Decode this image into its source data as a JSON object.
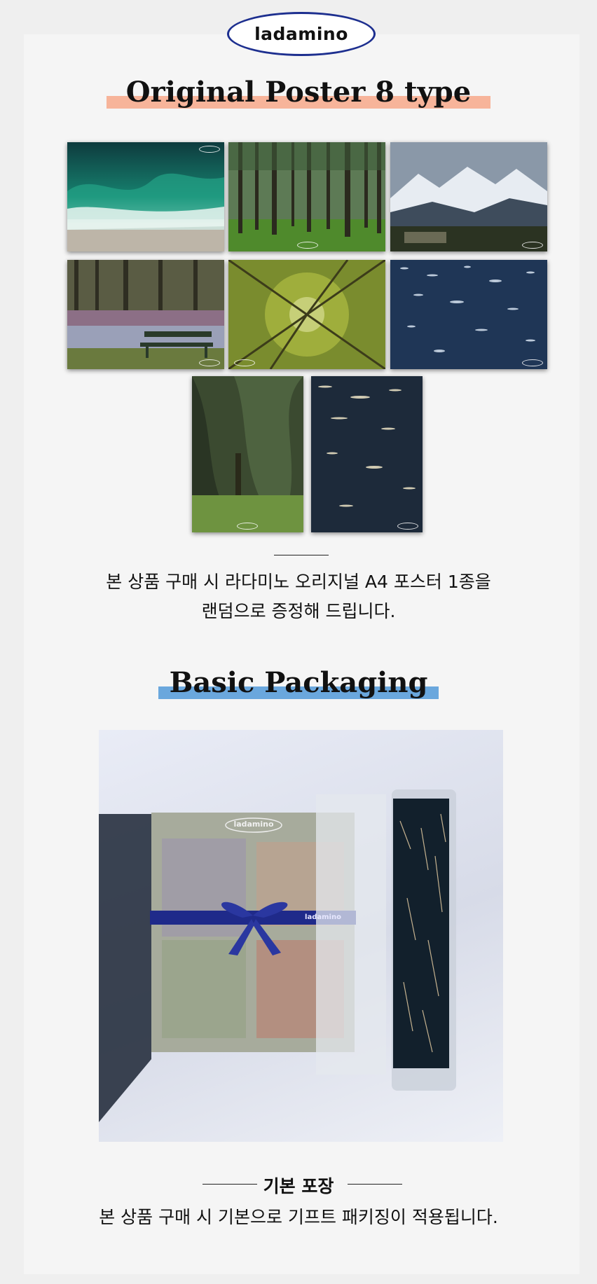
{
  "brand": {
    "logo_text": "ladamino",
    "logo_border_color": "#1d2f8f"
  },
  "poster_section": {
    "title": "Original Poster 8 type",
    "highlight_color": "#f7b49a",
    "photos": [
      {
        "subject": "ocean wave"
      },
      {
        "subject": "pine forest"
      },
      {
        "subject": "snowy mountains"
      },
      {
        "subject": "park bench by pond"
      },
      {
        "subject": "looking up at tree canopy"
      },
      {
        "subject": "sparkling water surface"
      },
      {
        "subject": "weeping willow trees"
      },
      {
        "subject": "glittering dark water"
      }
    ],
    "description_line1": "본 상품 구매 시 라다미노 오리지널 A4 포스터 1종을",
    "description_line2": "랜덤으로 증정해 드립니다."
  },
  "packaging_section": {
    "title": "Basic Packaging",
    "highlight_color": "#6aa7dd",
    "box_logo": "ladamino",
    "ribbon_text": "ladamino",
    "caption_title": "기본 포장",
    "caption_text": "본 상품 구매 시 기본으로 기프트 패키징이 적용됩니다."
  }
}
